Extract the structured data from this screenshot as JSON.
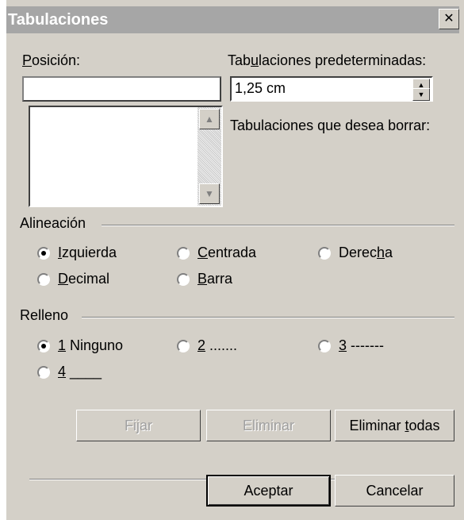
{
  "dialog": {
    "title": "Tabulaciones",
    "close_glyph": "✕"
  },
  "position": {
    "label": "Posición:",
    "value": "",
    "list_items": []
  },
  "default_tabs": {
    "label": "Tabulaciones predeterminadas:",
    "value": "1,25 cm"
  },
  "clear_tabs": {
    "label": "Tabulaciones que desea borrar:"
  },
  "alignment": {
    "label": "Alineación",
    "options": [
      "Izquierda",
      "Centrada",
      "Derecha",
      "Decimal",
      "Barra"
    ],
    "selected": "Izquierda"
  },
  "leader": {
    "label": "Relleno",
    "options": [
      "1 Ninguno",
      "2 .......",
      "3 -------",
      "4 ____"
    ],
    "selected": "1 Ninguno"
  },
  "buttons": {
    "set": "Fijar",
    "clear": "Eliminar",
    "clear_all": "Eliminar todas",
    "ok": "Aceptar",
    "cancel": "Cancelar"
  }
}
